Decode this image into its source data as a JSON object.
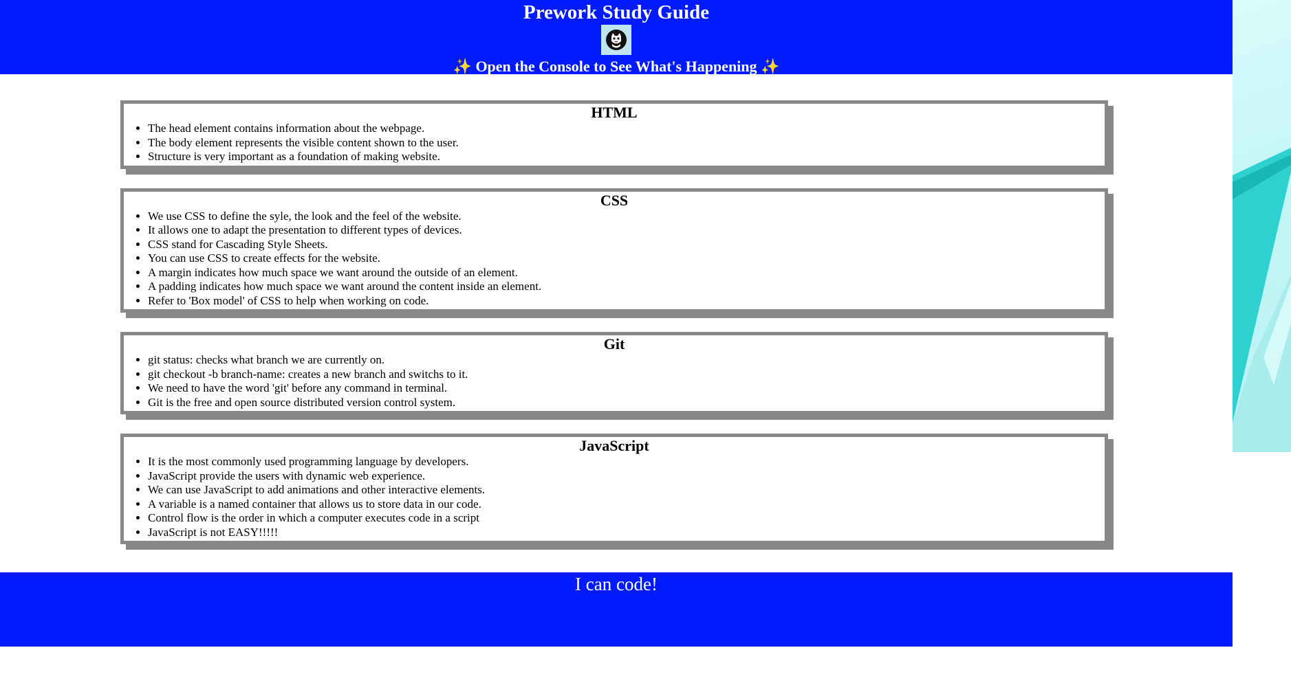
{
  "header": {
    "title": "Prework Study Guide",
    "logo_icon": "cat-logo-icon",
    "subtitle": "✨ Open the Console to See What's Happening ✨"
  },
  "sections": [
    {
      "heading": "HTML",
      "items": [
        "The head element contains information about the webpage.",
        "The body element represents the visible content shown to the user.",
        "Structure is very important as a foundation of making website."
      ]
    },
    {
      "heading": "CSS",
      "items": [
        "We use CSS to define the syle, the look and the feel of the website.",
        "It allows one to adapt the presentation to different types of devices.",
        "CSS stand for Cascading Style Sheets.",
        "You can use CSS to create effects for the website.",
        "A margin indicates how much space we want around the outside of an element.",
        "A padding indicates how much space we want around the content inside an element.",
        "Refer to 'Box model' of CSS to help when working on code."
      ]
    },
    {
      "heading": "Git",
      "items": [
        "git status: checks what branch we are currently on.",
        "git checkout -b branch-name: creates a new branch and switchs to it.",
        "We need to have the word 'git' before any command in terminal.",
        "Git is the free and open source distributed version control system."
      ]
    },
    {
      "heading": "JavaScript",
      "items": [
        "It is the most commonly used programming language by developers.",
        "JavaScript provide the users with dynamic web experience.",
        "We can use JavaScript to add animations and other interactive elements.",
        "A variable is a named container that allows us to store data in our code.",
        "Control flow is the order in which a computer executes code in a script",
        "JavaScript is not EASY!!!!!"
      ]
    }
  ],
  "footer": {
    "text": "I can code!"
  },
  "colors": {
    "banner_blue": "#001aff",
    "card_border": "#888888",
    "background_teal": "#c6f6f6"
  }
}
